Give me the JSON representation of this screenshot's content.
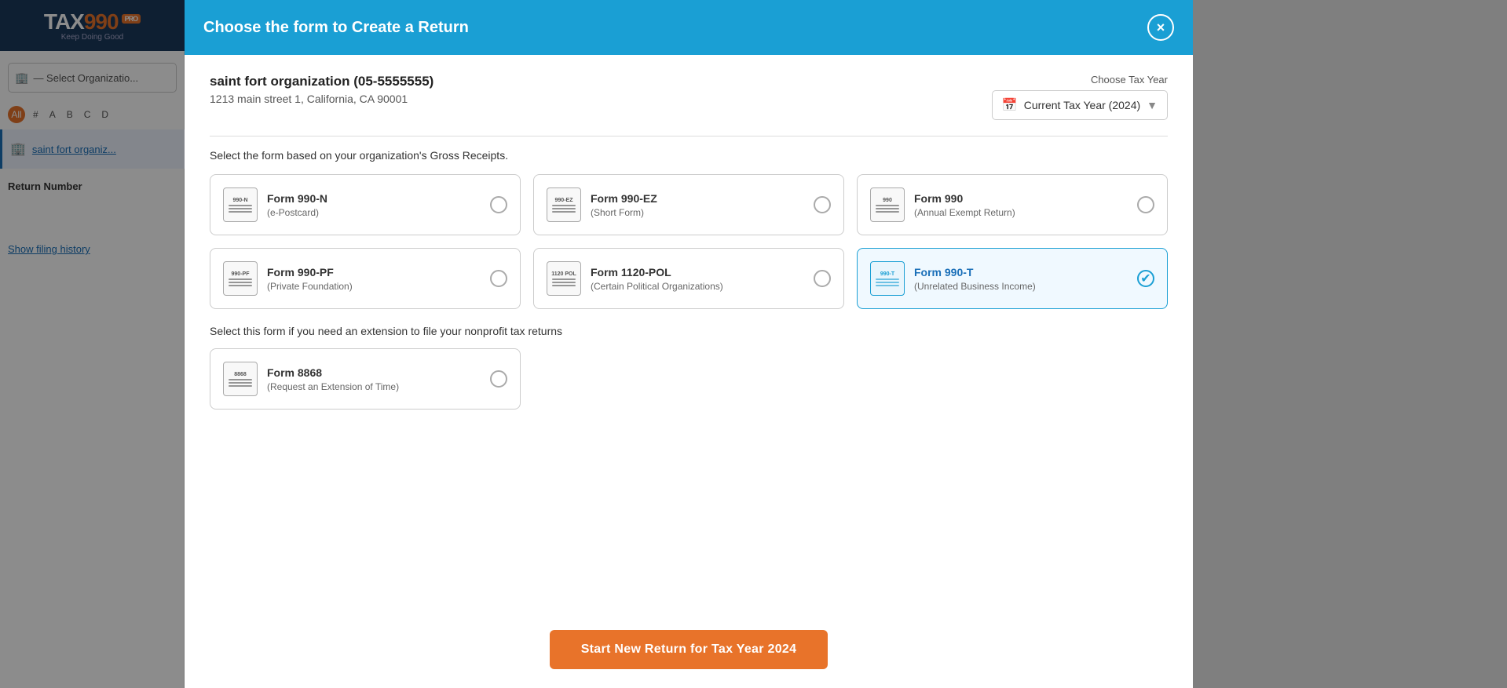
{
  "app": {
    "logo": "TAX990",
    "logo_highlight": "990",
    "tagline": "Keep Doing Good",
    "pro_badge": "PRO"
  },
  "sidebar": {
    "select_placeholder": "— Select Organizatio...",
    "alpha_items": [
      "All",
      "#",
      "A",
      "B",
      "C",
      "D"
    ],
    "active_alpha": "All",
    "org_name": "saint fort organiz...",
    "return_number_label": "Return Number",
    "show_history": "Show filing history"
  },
  "modal": {
    "title": "Choose the form to Create a Return",
    "close_label": "×",
    "org_name": "saint fort organization",
    "org_ein": "(05-5555555)",
    "org_address": "1213 main street 1, California, CA 90001",
    "tax_year_label": "Choose Tax Year",
    "tax_year_value": "Current Tax Year (2024)",
    "gross_receipts_label": "Select the form based on your organization's Gross Receipts.",
    "extension_label": "Select this form if you need an extension to file your nonprofit tax returns",
    "forms": [
      {
        "id": "990n",
        "icon_label": "990-N",
        "name": "Form 990-N",
        "subname": "(e-Postcard)",
        "selected": false
      },
      {
        "id": "990ez",
        "icon_label": "990-EZ",
        "name": "Form 990-EZ",
        "subname": "(Short Form)",
        "selected": false
      },
      {
        "id": "990",
        "icon_label": "990",
        "name": "Form 990",
        "subname": "(Annual Exempt Return)",
        "selected": false
      },
      {
        "id": "990pf",
        "icon_label": "990-PF",
        "name": "Form 990-PF",
        "subname": "(Private Foundation)",
        "selected": false
      },
      {
        "id": "1120pol",
        "icon_label": "1120 POL",
        "name": "Form 1120-POL",
        "subname": "(Certain Political Organizations)",
        "selected": false
      },
      {
        "id": "990t",
        "icon_label": "990-T",
        "name": "Form 990-T",
        "subname": "(Unrelated Business Income)",
        "selected": true
      }
    ],
    "extension_forms": [
      {
        "id": "8868",
        "icon_label": "8868",
        "name": "Form 8868",
        "subname": "(Request an Extension of Time)",
        "selected": false
      }
    ],
    "start_button": "Start New Return for Tax Year 2024"
  }
}
